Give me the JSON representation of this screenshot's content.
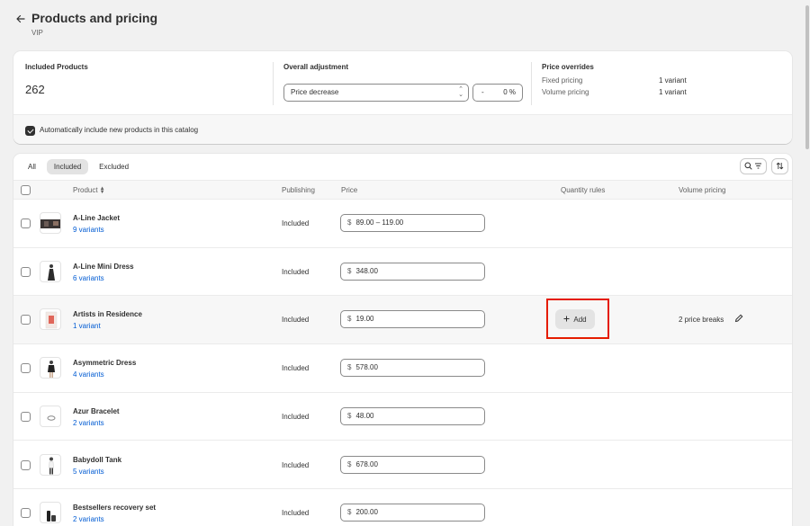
{
  "header": {
    "back_icon": "arrow-left-icon",
    "title": "Products and pricing",
    "subtitle": "VIP"
  },
  "summary": {
    "included_label": "Included Products",
    "included_count": "262",
    "adjustment_label": "Overall adjustment",
    "adjustment_select": "Price decrease",
    "adjustment_sign": "-",
    "adjustment_value": "0",
    "adjustment_unit": "%",
    "overrides_label": "Price overrides",
    "overrides": [
      {
        "label": "Fixed pricing",
        "value": "1 variant"
      },
      {
        "label": "Volume pricing",
        "value": "1 variant"
      }
    ],
    "auto_include_label": "Automatically include new products in this catalog",
    "auto_include_checked": true
  },
  "tabs": [
    "All",
    "Included",
    "Excluded"
  ],
  "active_tab": "Included",
  "columns": {
    "product": "Product",
    "publishing": "Publishing",
    "price": "Price",
    "quantity_rules": "Quantity rules",
    "volume_pricing": "Volume pricing"
  },
  "rows": [
    {
      "name": "A-Line Jacket",
      "variants": "9 variants",
      "publishing": "Included",
      "currency": "$",
      "price": "89.00 – 119.00"
    },
    {
      "name": "A-Line Mini Dress",
      "variants": "6 variants",
      "publishing": "Included",
      "currency": "$",
      "price": "348.00"
    },
    {
      "name": "Artists in Residence",
      "variants": "1 variant",
      "publishing": "Included",
      "currency": "$",
      "price": "19.00",
      "add_label": "Add",
      "volume": "2 price breaks"
    },
    {
      "name": "Asymmetric Dress",
      "variants": "4 variants",
      "publishing": "Included",
      "currency": "$",
      "price": "578.00"
    },
    {
      "name": "Azur Bracelet",
      "variants": "2 variants",
      "publishing": "Included",
      "currency": "$",
      "price": "48.00"
    },
    {
      "name": "Babydoll Tank",
      "variants": "5 variants",
      "publishing": "Included",
      "currency": "$",
      "price": "678.00"
    },
    {
      "name": "Bestsellers recovery set",
      "variants": "2 variants",
      "publishing": "Included",
      "currency": "$",
      "price": "200.00"
    }
  ],
  "colors": {
    "link": "#005bd3",
    "highlight_border": "#e51c00",
    "text": "#303030"
  }
}
